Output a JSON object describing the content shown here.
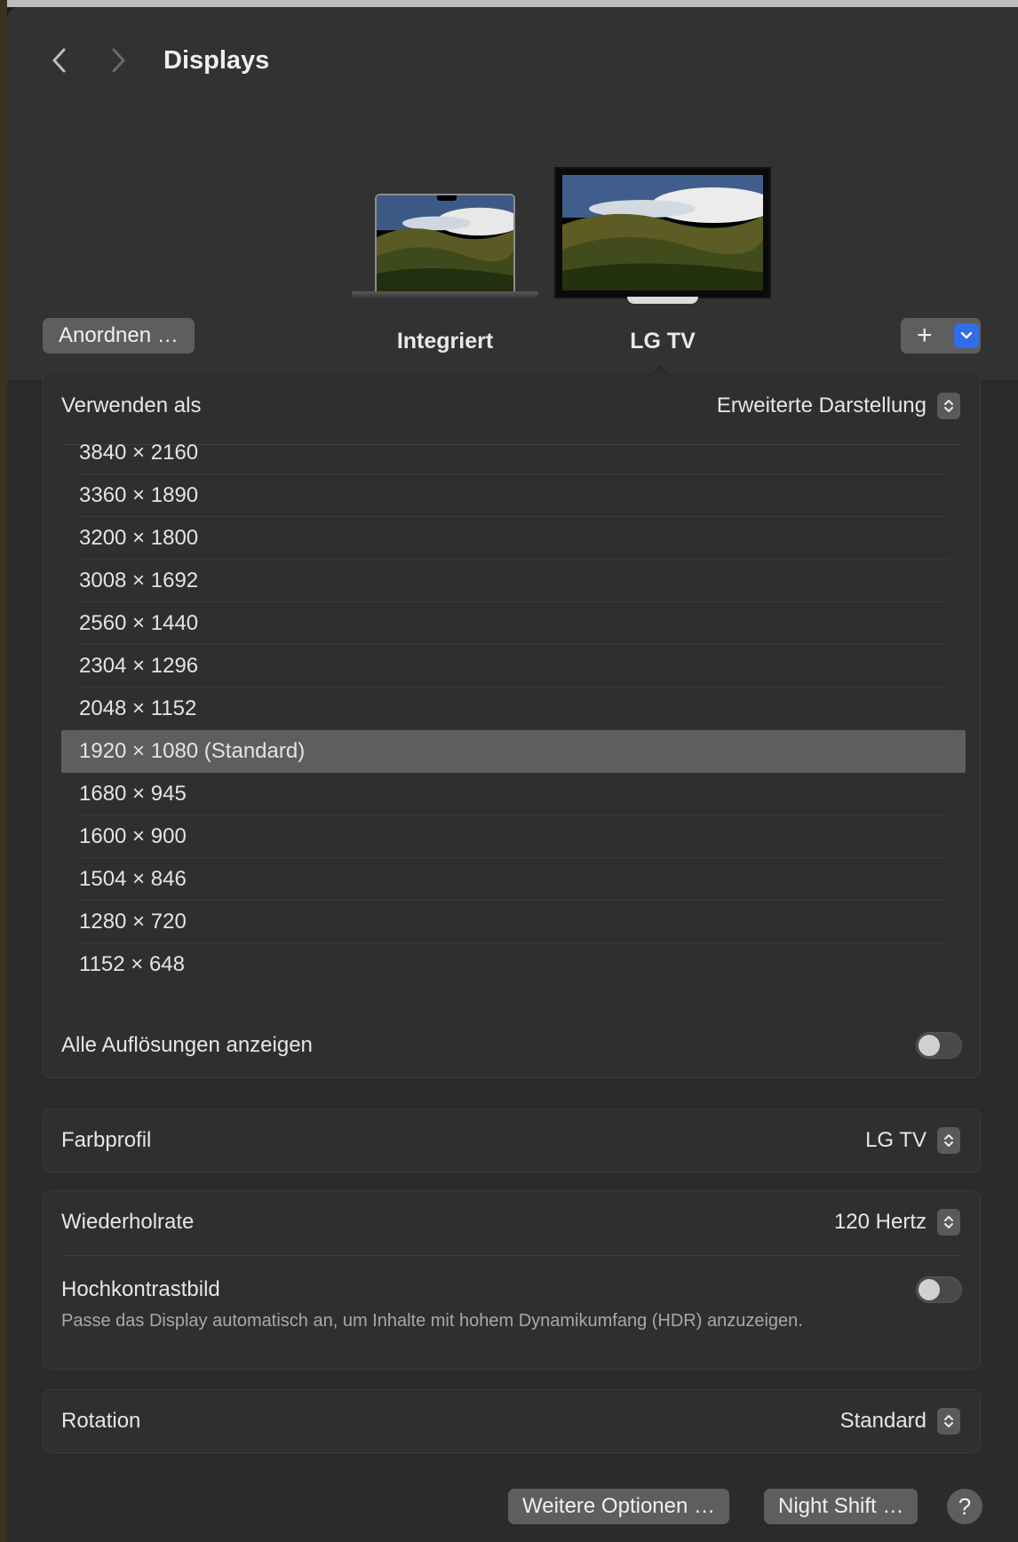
{
  "window": {
    "title": "Displays"
  },
  "displays": [
    {
      "label": "Integriert"
    },
    {
      "label": "LG TV"
    }
  ],
  "buttons": {
    "arrange": "Anordnen …",
    "add_plus": "+",
    "more_options": "Weitere Optionen …",
    "night_shift": "Night Shift …",
    "help": "?"
  },
  "use_as": {
    "label": "Verwenden als",
    "value": "Erweiterte Darstellung"
  },
  "resolutions": [
    "3840 × 2160",
    "3360 × 1890",
    "3200 × 1800",
    "3008 × 1692",
    "2560 × 1440",
    "2304 × 1296",
    "2048 × 1152",
    "1920 × 1080 (Standard)",
    "1680 × 945",
    "1600 × 900",
    "1504 × 846",
    "1280 × 720",
    "1152 × 648"
  ],
  "selected_resolution": "1920 × 1080 (Standard)",
  "show_all": {
    "label": "Alle Auflösungen anzeigen",
    "on": false
  },
  "color_profile": {
    "label": "Farbprofil",
    "value": "LG TV"
  },
  "refresh_rate": {
    "label": "Wiederholrate",
    "value": "120 Hertz"
  },
  "hdr": {
    "label": "Hochkontrastbild",
    "description": "Passe das Display automatisch an, um Inhalte mit hohem Dynamikumfang (HDR) anzuzeigen.",
    "on": false
  },
  "rotation": {
    "label": "Rotation",
    "value": "Standard"
  },
  "colors": {
    "accent": "#2f6ee8",
    "selected_row": "#5e5e5e",
    "window_bg": "#2b2b2b"
  }
}
